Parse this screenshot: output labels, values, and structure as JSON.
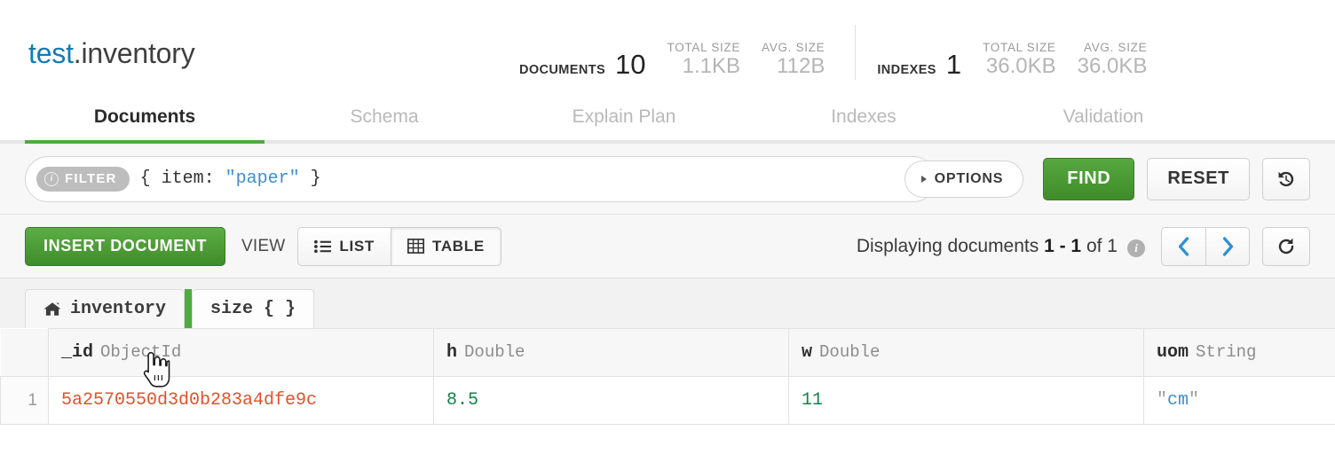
{
  "header": {
    "namespace_db": "test",
    "namespace_sep": ".",
    "namespace_collection": "inventory",
    "documents_label": "DOCUMENTS",
    "documents_count": "10",
    "documents_total_size_label": "TOTAL SIZE",
    "documents_total_size": "1.1KB",
    "documents_avg_size_label": "AVG. SIZE",
    "documents_avg_size": "112B",
    "indexes_label": "INDEXES",
    "indexes_count": "1",
    "indexes_total_size_label": "TOTAL SIZE",
    "indexes_total_size": "36.0KB",
    "indexes_avg_size_label": "AVG. SIZE",
    "indexes_avg_size": "36.0KB"
  },
  "tabs": [
    {
      "label": "Documents",
      "active": true
    },
    {
      "label": "Schema",
      "active": false
    },
    {
      "label": "Explain Plan",
      "active": false
    },
    {
      "label": "Indexes",
      "active": false
    },
    {
      "label": "Validation",
      "active": false
    }
  ],
  "query_bar": {
    "filter_badge": "FILTER",
    "filter_icon": "info-circle-icon",
    "query_prefix": "{ item: ",
    "query_string": "\"paper\"",
    "query_suffix": " }",
    "options_label": "OPTIONS",
    "find_label": "FIND",
    "reset_label": "RESET",
    "history_icon": "history-clock-icon"
  },
  "toolbar": {
    "insert_label": "INSERT DOCUMENT",
    "view_label": "VIEW",
    "list_label": "LIST",
    "list_icon": "list-icon",
    "table_label": "TABLE",
    "table_icon": "grid-icon",
    "active_view": "TABLE",
    "pager_prefix": "Displaying documents ",
    "pager_range": "1 - 1",
    "pager_suffix": " of 1",
    "pager_info_icon": "info-circle-icon",
    "prev_icon": "chevron-left-icon",
    "next_icon": "chevron-right-icon",
    "refresh_icon": "refresh-icon"
  },
  "breadcrumb": {
    "home_icon": "home-icon",
    "items": [
      {
        "label": "inventory",
        "active": false
      },
      {
        "label": "size { }",
        "active": true
      }
    ]
  },
  "table": {
    "columns": [
      {
        "name": "_id",
        "type": "ObjectId"
      },
      {
        "name": "h",
        "type": "Double"
      },
      {
        "name": "w",
        "type": "Double"
      },
      {
        "name": "uom",
        "type": "String"
      }
    ],
    "rows": [
      {
        "num": "1",
        "id": "5a2570550d3d0b283a4dfe9c",
        "h": "8.5",
        "w": "11",
        "uom_open_quote": "\"",
        "uom": "cm",
        "uom_close_quote": "\""
      }
    ]
  },
  "colors": {
    "accent_green": "#4faa41",
    "link_blue": "#127bb6",
    "objectid_orange": "#e2512a",
    "number_green": "#11834a",
    "string_blue": "#3f8fd0"
  }
}
